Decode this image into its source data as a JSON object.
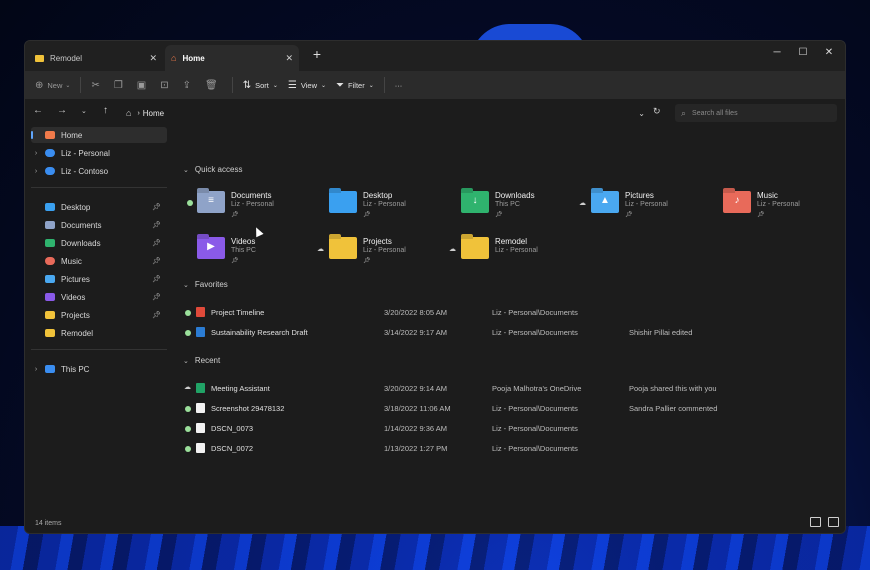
{
  "tabs": [
    {
      "label": "Remodel",
      "icon": "folder-icon",
      "active": false
    },
    {
      "label": "Home",
      "icon": "home-icon",
      "active": true
    }
  ],
  "window_controls": {
    "minimize": "─",
    "maximize": "☐",
    "close": "✕"
  },
  "toolbar": {
    "new_label": "New",
    "sort_label": "Sort",
    "view_label": "View",
    "filter_label": "Filter",
    "more_label": "···"
  },
  "address": {
    "breadcrumb": "Home",
    "search_placeholder": "Search all files"
  },
  "sidebar": {
    "top": [
      {
        "label": "Home",
        "icon": "home-icon",
        "color": "#f07a4a",
        "selected": true
      },
      {
        "label": "Liz - Personal",
        "icon": "onedrive-icon",
        "color": "#3a8df0"
      },
      {
        "label": "Liz - Contoso",
        "icon": "onedrive-icon",
        "color": "#3a8df0"
      }
    ],
    "pinned": [
      {
        "label": "Desktop",
        "icon": "desktop-folder-icon",
        "color": "#3aa0f0",
        "pinned": true
      },
      {
        "label": "Documents",
        "icon": "documents-folder-icon",
        "color": "#8fa3c8",
        "pinned": true
      },
      {
        "label": "Downloads",
        "icon": "downloads-folder-icon",
        "color": "#2fb36e",
        "pinned": true
      },
      {
        "label": "Music",
        "icon": "music-folder-icon",
        "color": "#e86a5a",
        "pinned": true
      },
      {
        "label": "Pictures",
        "icon": "pictures-folder-icon",
        "color": "#4aa8f0",
        "pinned": true
      },
      {
        "label": "Videos",
        "icon": "videos-folder-icon",
        "color": "#8a5ae8",
        "pinned": true
      },
      {
        "label": "Projects",
        "icon": "folder-icon",
        "color": "#f0c23a",
        "pinned": true
      },
      {
        "label": "Remodel",
        "icon": "folder-icon",
        "color": "#f0c23a",
        "pinned": false
      }
    ],
    "this_pc": {
      "label": "This PC",
      "icon": "computer-icon",
      "color": "#3a8df0"
    }
  },
  "quick_access": {
    "title": "Quick access",
    "items": [
      {
        "name": "Documents",
        "sub": "Liz - Personal",
        "status": "synced",
        "pinned": true,
        "icon": "documents-folder-icon",
        "color": "#8fa3c8",
        "glyph": "≡"
      },
      {
        "name": "Desktop",
        "sub": "Liz - Personal",
        "status": "none",
        "pinned": true,
        "icon": "desktop-folder-icon",
        "color": "#3aa0f0",
        "glyph": ""
      },
      {
        "name": "Downloads",
        "sub": "This PC",
        "status": "none",
        "pinned": true,
        "icon": "downloads-folder-icon",
        "color": "#2fb36e",
        "glyph": "↓"
      },
      {
        "name": "Pictures",
        "sub": "Liz - Personal",
        "status": "cloud",
        "pinned": true,
        "icon": "pictures-folder-icon",
        "color": "#4aa8f0",
        "glyph": "▲"
      },
      {
        "name": "Music",
        "sub": "Liz - Personal",
        "status": "none",
        "pinned": true,
        "icon": "music-folder-icon",
        "color": "#e86a5a",
        "glyph": "♪"
      },
      {
        "name": "Videos",
        "sub": "This PC",
        "status": "none",
        "pinned": true,
        "icon": "videos-folder-icon",
        "color": "#8a5ae8",
        "glyph": "▶"
      },
      {
        "name": "Projects",
        "sub": "Liz - Personal",
        "status": "cloud",
        "pinned": true,
        "icon": "folder-icon",
        "color": "#f0c23a",
        "glyph": ""
      },
      {
        "name": "Remodel",
        "sub": "Liz - Personal",
        "status": "cloud",
        "pinned": false,
        "icon": "folder-icon",
        "color": "#f0c23a",
        "glyph": ""
      }
    ]
  },
  "favorites": {
    "title": "Favorites",
    "rows": [
      {
        "name": "Project Timeline",
        "date": "3/20/2022 8:05 AM",
        "location": "Liz - Personal\\Documents",
        "activity": "",
        "status": "synced",
        "file_icon": "pdf-icon",
        "icon_color": "#e04a3a"
      },
      {
        "name": "Sustainability Research Draft",
        "date": "3/14/2022 9:17 AM",
        "location": "Liz - Personal\\Documents",
        "activity": "Shishir Pillai edited",
        "status": "synced",
        "file_icon": "word-icon",
        "icon_color": "#2b7cd3"
      }
    ]
  },
  "recent": {
    "title": "Recent",
    "rows": [
      {
        "name": "Meeting Assistant",
        "date": "3/20/2022 9:14 AM",
        "location": "Pooja Malhotra's OneDrive",
        "activity": "Pooja shared this with you",
        "status": "cloud",
        "file_icon": "excel-icon",
        "icon_color": "#21a366"
      },
      {
        "name": "Screenshot 29478132",
        "date": "3/18/2022 11:06 AM",
        "location": "Liz - Personal\\Documents",
        "activity": "Sandra Pallier commented",
        "status": "synced",
        "file_icon": "image-file-icon",
        "icon_color": "#f2f2f2"
      },
      {
        "name": "DSCN_0073",
        "date": "1/14/2022 9:36 AM",
        "location": "Liz - Personal\\Documents",
        "activity": "",
        "status": "synced",
        "file_icon": "image-file-icon",
        "icon_color": "#f2f2f2"
      },
      {
        "name": "DSCN_0072",
        "date": "1/13/2022 1:27 PM",
        "location": "Liz - Personal\\Documents",
        "activity": "",
        "status": "synced",
        "file_icon": "image-file-icon",
        "icon_color": "#f2f2f2"
      }
    ]
  },
  "status_bar": {
    "item_count": "14 items"
  }
}
